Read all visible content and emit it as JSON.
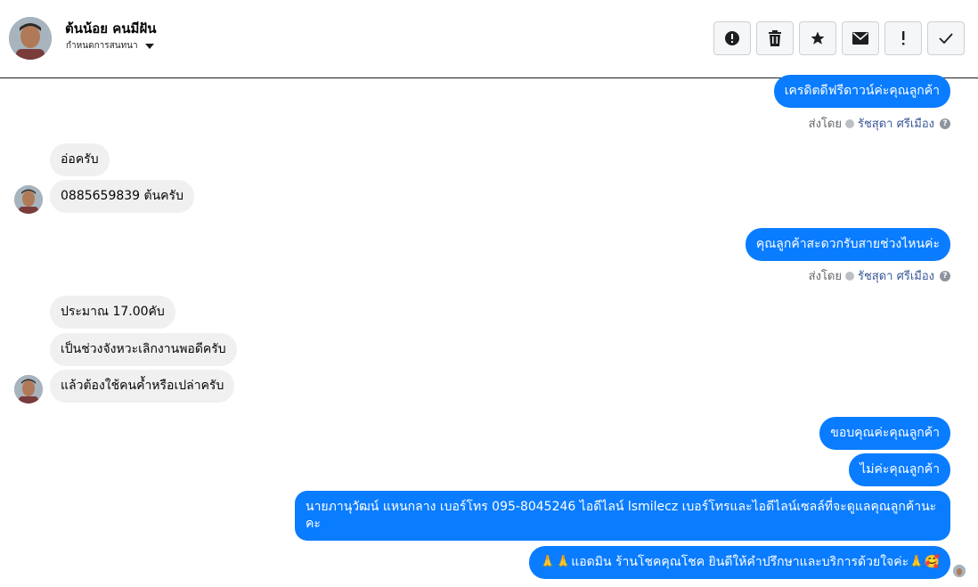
{
  "header": {
    "contact_name": "ต้นน้อย คนมีฝัน",
    "assign_label": "กำหนดการสนทนา"
  },
  "toolbar": [
    {
      "name": "spam-button",
      "icon": "alert-circle-icon"
    },
    {
      "name": "delete-button",
      "icon": "trash-icon"
    },
    {
      "name": "star-button",
      "icon": "star-icon"
    },
    {
      "name": "mark-unread-button",
      "icon": "envelope-icon"
    },
    {
      "name": "follow-up-button",
      "icon": "exclamation-icon"
    },
    {
      "name": "mark-done-button",
      "icon": "check-icon"
    }
  ],
  "messages": {
    "m1": "เครดิตดีฟรีดาวน์ค่ะคุณลูกค้า",
    "sent_by_label": "ส่งโดย",
    "agent_name": "รัชสุดา ศรีเมือง",
    "m2": "อ่อครับ",
    "m3": "0885659839 ต้นครับ",
    "m4": "คุณลูกค้าสะดวกรับสายช่วงไหนค่ะ",
    "m5": "ประมาณ 17.00คับ",
    "m6": "เป็นช่วงจังหวะเลิกงานพอดีครับ",
    "m7": "แล้วต้องใช้คนค้ำหรือเปล่าครับ",
    "m8": "ขอบคุณค่ะคุณลูกค้า",
    "m9": "ไม่ค่ะคุณลูกค้า",
    "m10": "นายภานุวัฒน์ แหนกลาง เบอร์โทร 095-8045246 ไอดีไลน์ lsmilecz   เบอร์โทรและไอดีไลน์เซลล์ที่จะดูแลคุณลูกค้านะคะ",
    "m11": "🙏🙏แอดมิน ร้านโชคคุณโชค ยินดีให้คำปรึกษาและบริการด้วยใจค่ะ🙏🥰"
  }
}
